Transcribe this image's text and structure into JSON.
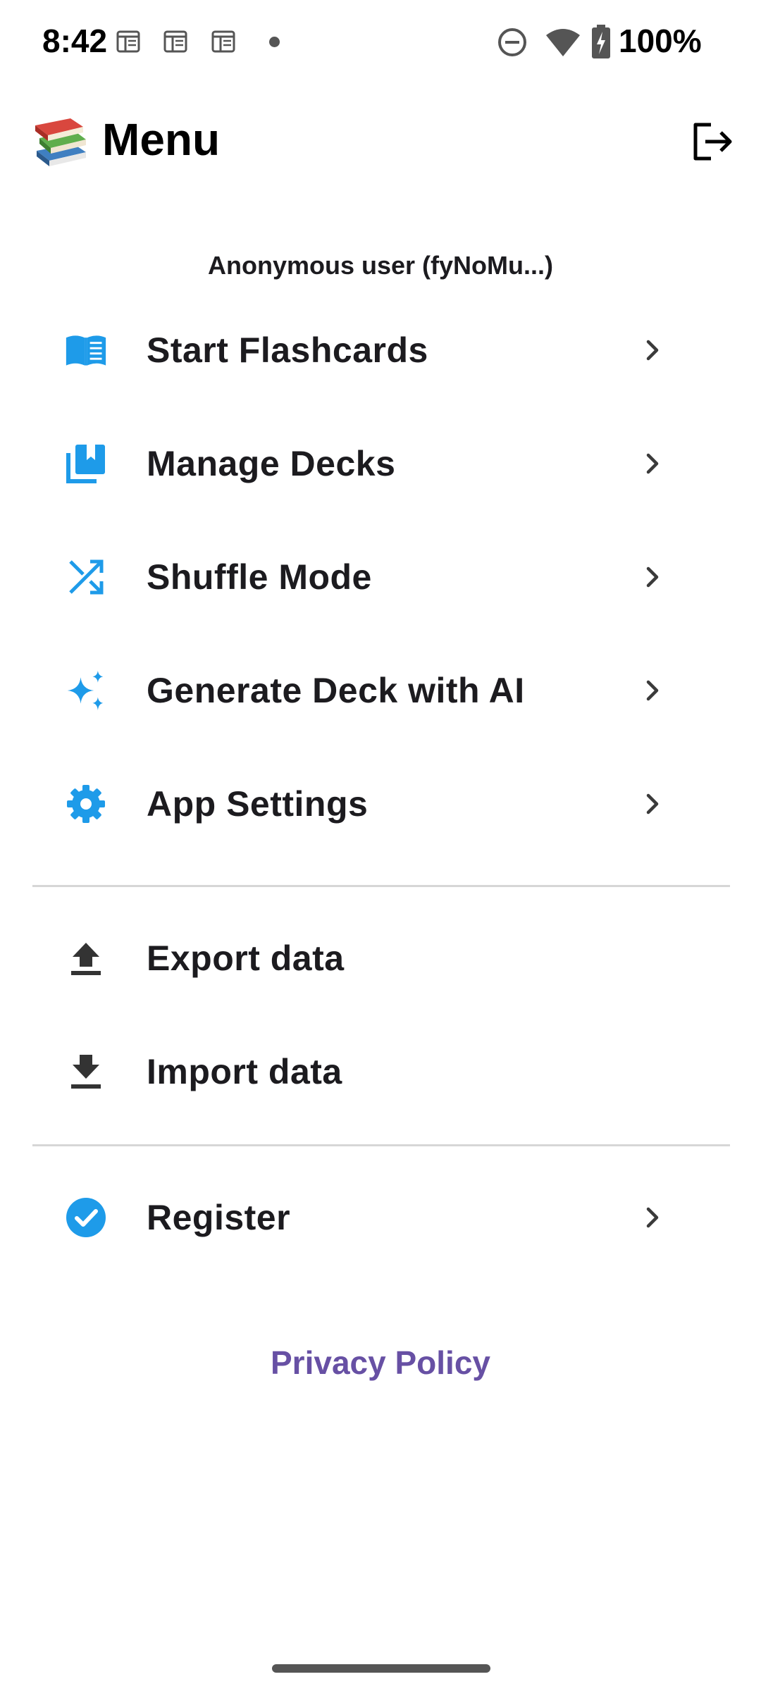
{
  "status_bar": {
    "time": "8:42",
    "battery": "100%"
  },
  "header": {
    "title": "Menu",
    "logout_icon": "logout-icon"
  },
  "user": {
    "label": "Anonymous user (fyNoMu...)"
  },
  "menu": {
    "items": [
      {
        "label": "Start Flashcards",
        "icon": "book-icon"
      },
      {
        "label": "Manage Decks",
        "icon": "library-icon"
      },
      {
        "label": "Shuffle Mode",
        "icon": "shuffle-icon"
      },
      {
        "label": "Generate Deck with AI",
        "icon": "sparkles-icon"
      },
      {
        "label": "App Settings",
        "icon": "gear-icon"
      }
    ],
    "data_items": [
      {
        "label": "Export data",
        "icon": "upload-icon"
      },
      {
        "label": "Import data",
        "icon": "download-icon"
      }
    ],
    "account_items": [
      {
        "label": "Register",
        "icon": "check-circle-icon"
      }
    ]
  },
  "footer": {
    "privacy_policy": "Privacy Policy"
  },
  "colors": {
    "accent": "#1e9be9",
    "link": "#6750a4",
    "text": "#1c1b1f",
    "divider": "#d6d6d6"
  }
}
